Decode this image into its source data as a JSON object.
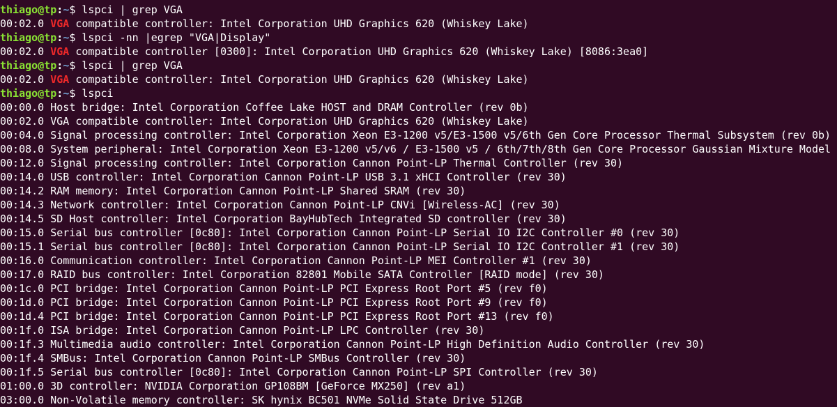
{
  "prompt": {
    "user": "thiago",
    "at": "@",
    "host": "tp",
    "colon": ":",
    "path": "~",
    "dollar": "$ "
  },
  "colors": {
    "background": "#300a24",
    "text": "#ffffff",
    "prompt_user": "#8ae234",
    "prompt_path": "#729fcf",
    "grep_match": "#ef2929"
  },
  "session": [
    {
      "type": "command",
      "text": "lspci | grep VGA"
    },
    {
      "type": "match",
      "pre": "00:02.0 ",
      "match": "VGA",
      "post": " compatible controller: Intel Corporation UHD Graphics 620 (Whiskey Lake)"
    },
    {
      "type": "command",
      "text": "lspci -nn |egrep \"VGA|Display\""
    },
    {
      "type": "match",
      "pre": "00:02.0 ",
      "match": "VGA",
      "post": " compatible controller [0300]: Intel Corporation UHD Graphics 620 (Whiskey Lake) [8086:3ea0]"
    },
    {
      "type": "command",
      "text": "lspci | grep VGA"
    },
    {
      "type": "match",
      "pre": "00:02.0 ",
      "match": "VGA",
      "post": " compatible controller: Intel Corporation UHD Graphics 620 (Whiskey Lake)"
    },
    {
      "type": "command",
      "text": "lspci"
    },
    {
      "type": "output",
      "text": "00:00.0 Host bridge: Intel Corporation Coffee Lake HOST and DRAM Controller (rev 0b)"
    },
    {
      "type": "output",
      "text": "00:02.0 VGA compatible controller: Intel Corporation UHD Graphics 620 (Whiskey Lake)"
    },
    {
      "type": "output",
      "text": "00:04.0 Signal processing controller: Intel Corporation Xeon E3-1200 v5/E3-1500 v5/6th Gen Core Processor Thermal Subsystem (rev 0b)"
    },
    {
      "type": "output",
      "text": "00:08.0 System peripheral: Intel Corporation Xeon E3-1200 v5/v6 / E3-1500 v5 / 6th/7th/8th Gen Core Processor Gaussian Mixture Model"
    },
    {
      "type": "output",
      "text": "00:12.0 Signal processing controller: Intel Corporation Cannon Point-LP Thermal Controller (rev 30)"
    },
    {
      "type": "output",
      "text": "00:14.0 USB controller: Intel Corporation Cannon Point-LP USB 3.1 xHCI Controller (rev 30)"
    },
    {
      "type": "output",
      "text": "00:14.2 RAM memory: Intel Corporation Cannon Point-LP Shared SRAM (rev 30)"
    },
    {
      "type": "output",
      "text": "00:14.3 Network controller: Intel Corporation Cannon Point-LP CNVi [Wireless-AC] (rev 30)"
    },
    {
      "type": "output",
      "text": "00:14.5 SD Host controller: Intel Corporation BayHubTech Integrated SD controller (rev 30)"
    },
    {
      "type": "output",
      "text": "00:15.0 Serial bus controller [0c80]: Intel Corporation Cannon Point-LP Serial IO I2C Controller #0 (rev 30)"
    },
    {
      "type": "output",
      "text": "00:15.1 Serial bus controller [0c80]: Intel Corporation Cannon Point-LP Serial IO I2C Controller #1 (rev 30)"
    },
    {
      "type": "output",
      "text": "00:16.0 Communication controller: Intel Corporation Cannon Point-LP MEI Controller #1 (rev 30)"
    },
    {
      "type": "output",
      "text": "00:17.0 RAID bus controller: Intel Corporation 82801 Mobile SATA Controller [RAID mode] (rev 30)"
    },
    {
      "type": "output",
      "text": "00:1c.0 PCI bridge: Intel Corporation Cannon Point-LP PCI Express Root Port #5 (rev f0)"
    },
    {
      "type": "output",
      "text": "00:1d.0 PCI bridge: Intel Corporation Cannon Point-LP PCI Express Root Port #9 (rev f0)"
    },
    {
      "type": "output",
      "text": "00:1d.4 PCI bridge: Intel Corporation Cannon Point-LP PCI Express Root Port #13 (rev f0)"
    },
    {
      "type": "output",
      "text": "00:1f.0 ISA bridge: Intel Corporation Cannon Point-LP LPC Controller (rev 30)"
    },
    {
      "type": "output",
      "text": "00:1f.3 Multimedia audio controller: Intel Corporation Cannon Point-LP High Definition Audio Controller (rev 30)"
    },
    {
      "type": "output",
      "text": "00:1f.4 SMBus: Intel Corporation Cannon Point-LP SMBus Controller (rev 30)"
    },
    {
      "type": "output",
      "text": "00:1f.5 Serial bus controller [0c80]: Intel Corporation Cannon Point-LP SPI Controller (rev 30)"
    },
    {
      "type": "output",
      "text": "01:00.0 3D controller: NVIDIA Corporation GP108BM [GeForce MX250] (rev a1)"
    },
    {
      "type": "output",
      "text": "03:00.0 Non-Volatile memory controller: SK hynix BC501 NVMe Solid State Drive 512GB"
    }
  ]
}
